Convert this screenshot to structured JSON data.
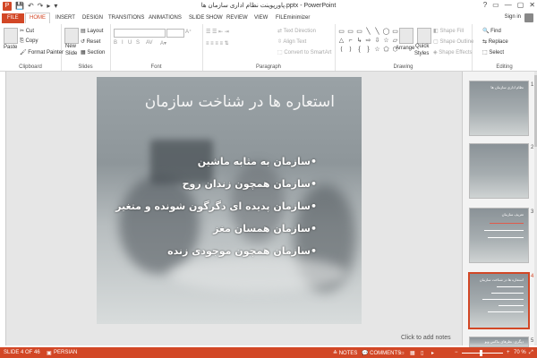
{
  "titlebar": {
    "app_icon": "P",
    "title": "پاورپوینت نظام اداری سازمان ها.pptx - PowerPoint",
    "qat": [
      "💾",
      "↶",
      "↷",
      "▸",
      "▾"
    ],
    "controls": [
      "?",
      "▭",
      "—",
      "▢",
      "✕"
    ]
  },
  "ribbon_tabs": [
    "FILE",
    "HOME",
    "INSERT",
    "DESIGN",
    "TRANSITIONS",
    "ANIMATIONS",
    "SLIDE SHOW",
    "REVIEW",
    "VIEW",
    "FILEminimizer"
  ],
  "account": {
    "signin": "Sign in"
  },
  "clipboard": {
    "paste": "Paste",
    "cut": "Cut",
    "copy": "Copy",
    "format_painter": "Format Painter",
    "label": "Clipboard"
  },
  "slides_group": {
    "new_slide": "New",
    "new_slide2": "Slide",
    "layout": "Layout",
    "reset": "Reset",
    "section": "Section",
    "label": "Slides"
  },
  "font_group": {
    "bold": "B",
    "italic": "I",
    "underline": "U",
    "strike": "S",
    "label": "Font"
  },
  "paragraph_group": {
    "text_direction": "Text Direction",
    "align_text": "Align Text",
    "convert_smartart": "Convert to SmartArt",
    "label": "Paragraph"
  },
  "drawing_group": {
    "arrange": "Arrange",
    "quick_styles": "Quick",
    "quick_styles2": "Styles",
    "shape_fill": "Shape Fill",
    "shape_outline": "Shape Outline",
    "shape_effects": "Shape Effects",
    "shapes": [
      "▭",
      "▭",
      "▭",
      "╲",
      "╲",
      "◯",
      "▭",
      "△",
      "⌐",
      "↳",
      "⇨",
      "⇩",
      "☆",
      "▱",
      "⟨",
      "⟩",
      "{",
      "}",
      "☆",
      "⬠",
      "⬡"
    ],
    "label": "Drawing"
  },
  "editing_group": {
    "find": "Find",
    "replace": "Replace",
    "select": "Select",
    "label": "Editing"
  },
  "slide": {
    "title": "استعاره ها در شناخت سازمان",
    "bullets": [
      "•سازمان به مثابه ماشین",
      "•سازمان همچون زندان روح",
      "•سازمان پدیده ای دگرگون شونده و متغیر",
      "•سازمان همسان مغز",
      "•سازمان همچون موجودی زنده"
    ]
  },
  "notes_hint": "Click to add notes",
  "thumbnails": [
    {
      "num": "1",
      "title": "نظام اداری سازمان ها"
    },
    {
      "num": "2",
      "title": ""
    },
    {
      "num": "3",
      "title": "تعریف سازمان"
    },
    {
      "num": "4",
      "title": "استعاره ها در شناخت سازمان"
    },
    {
      "num": "5",
      "title": "دیگری: نظرهای ماکس ویو"
    }
  ],
  "statusbar": {
    "slide": "SLIDE 4 OF 46",
    "language": "PERSIAN",
    "notes": "NOTES",
    "comments": "COMMENTS",
    "zoom": "70 %"
  },
  "colors": {
    "accent": "#d24726"
  }
}
